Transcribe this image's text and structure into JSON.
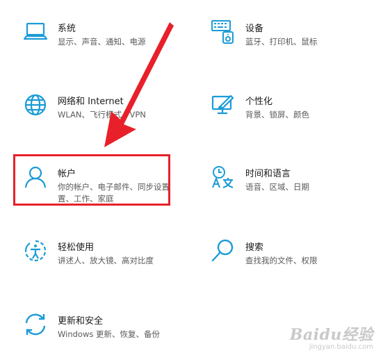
{
  "accent": "#1a9bd7",
  "highlight_color": "#e8202a",
  "settings": {
    "system": {
      "title": "系统",
      "desc": "显示、声音、通知、电源",
      "icon": "laptop-icon"
    },
    "devices": {
      "title": "设备",
      "desc": "蓝牙、打印机、鼠标",
      "icon": "keyboard-icon"
    },
    "network": {
      "title": "网络和 Internet",
      "desc": "WLAN、飞行模式、VPN",
      "icon": "globe-icon"
    },
    "personalization": {
      "title": "个性化",
      "desc": "背景、锁屏、颜色",
      "icon": "paint-brush-icon"
    },
    "accounts": {
      "title": "帐户",
      "desc_line1": "你的帐户、电子邮件、同步设置",
      "desc_line2": "置、工作、家庭",
      "icon": "person-icon"
    },
    "time_language": {
      "title": "时间和语言",
      "desc": "语音、区域、日期",
      "icon": "time-language-icon"
    },
    "ease_of_access": {
      "title": "轻松使用",
      "desc": "讲述人、放大镜、高对比度",
      "icon": "ease-of-access-icon"
    },
    "search": {
      "title": "搜索",
      "desc": "查找我的文件、权限",
      "icon": "search-icon"
    },
    "update_security": {
      "title": "更新和安全",
      "desc": "Windows 更新、恢复、备份",
      "icon": "sync-icon"
    }
  },
  "watermark": {
    "brand": "Baidu经验",
    "url": "jingyan.baidu.com"
  }
}
